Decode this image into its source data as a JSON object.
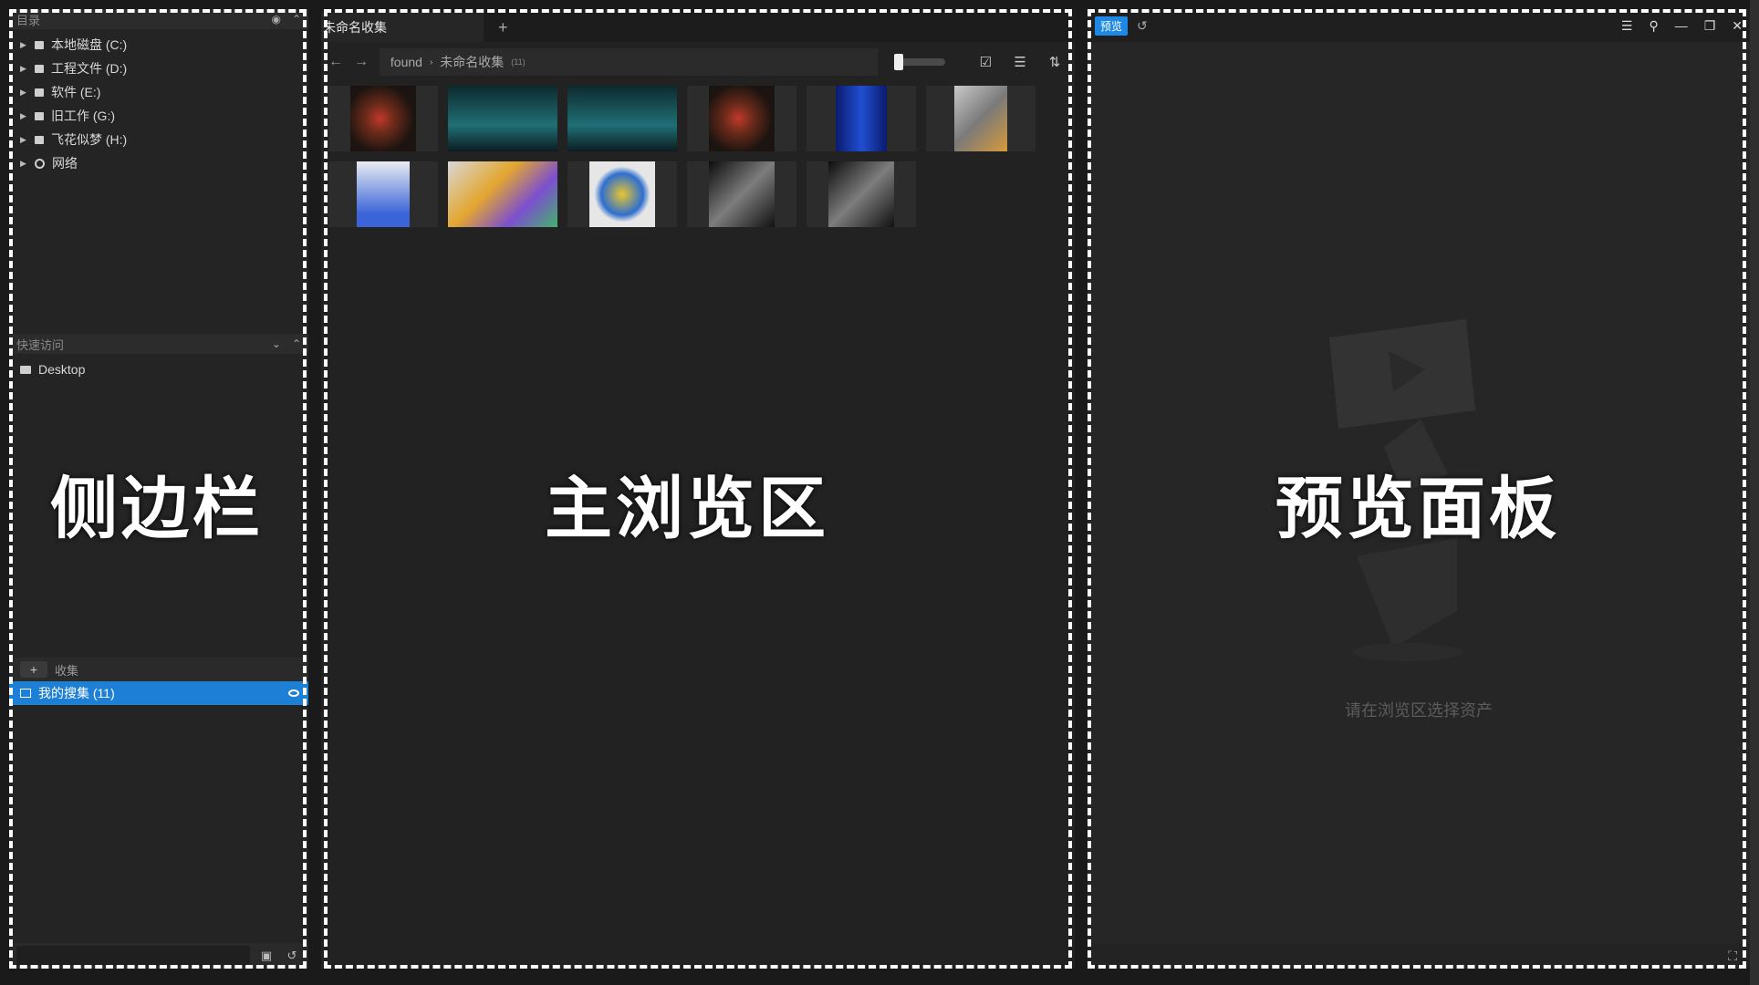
{
  "sidebar": {
    "directory_header": "目录",
    "drives": [
      {
        "label": "本地磁盘 (C:)"
      },
      {
        "label": "工程文件 (D:)"
      },
      {
        "label": "软件 (E:)"
      },
      {
        "label": "旧工作 (G:)"
      },
      {
        "label": "飞花似梦 (H:)"
      }
    ],
    "network_label": "网络",
    "quick_access_header": "快速访问",
    "quick_access_items": [
      {
        "label": "Desktop"
      }
    ],
    "collections_header": "收集",
    "collections_add": "+",
    "selected_collection": "我的搜集 (11)",
    "overlay_label": "侧边栏"
  },
  "browser": {
    "tab_label": "未命名收集",
    "tab_add": "+",
    "breadcrumb_root": "found",
    "breadcrumb_current": "未命名收集",
    "breadcrumb_count": "(11)",
    "overlay_label": "主浏览区",
    "thumbnails": [
      {
        "kind": "warm-dark"
      },
      {
        "kind": "city-teal"
      },
      {
        "kind": "city-teal"
      },
      {
        "kind": "warm-dark"
      },
      {
        "kind": "blue-figure"
      },
      {
        "kind": "iso-gray"
      },
      {
        "kind": "blue-white"
      },
      {
        "kind": "colorful"
      },
      {
        "kind": "yellow-box"
      },
      {
        "kind": "mono-dark"
      },
      {
        "kind": "mono-dark"
      }
    ]
  },
  "preview": {
    "badge": "预览",
    "empty_text": "请在浏览区选择资产",
    "overlay_label": "预览面板"
  },
  "colors": {
    "accent": "#1e7fd6",
    "badge": "#1e88e5",
    "panel": "#242424"
  }
}
